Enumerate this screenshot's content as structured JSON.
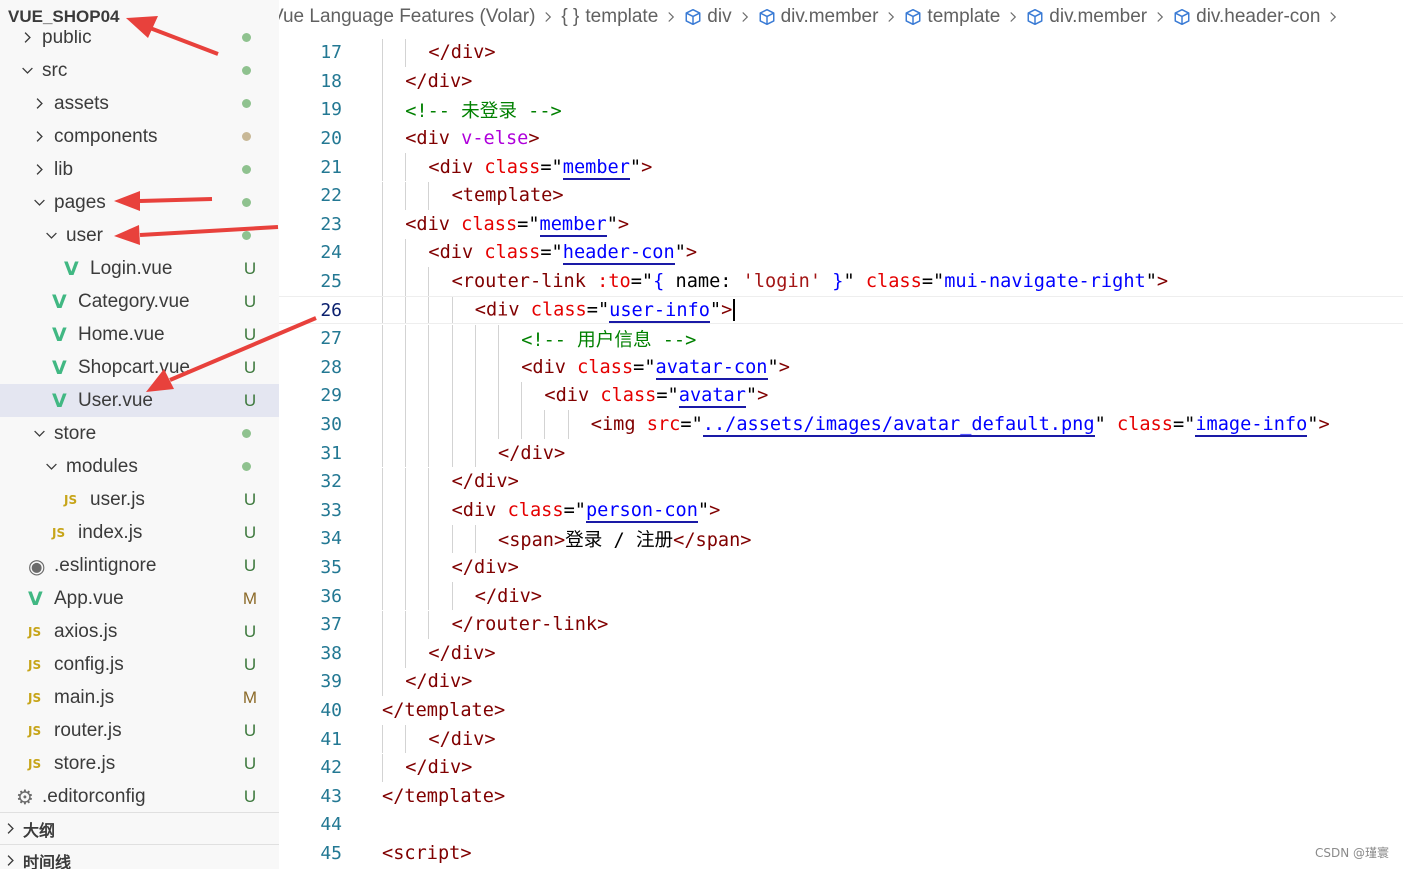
{
  "explorer": {
    "root": "VUE_SHOP04",
    "items": [
      {
        "label": "public",
        "kind": "folder",
        "open": false,
        "depth": 0,
        "status": "dot"
      },
      {
        "label": "src",
        "kind": "folder",
        "open": true,
        "depth": 0,
        "status": "dot"
      },
      {
        "label": "assets",
        "kind": "folder",
        "open": false,
        "depth": 1,
        "status": "dot"
      },
      {
        "label": "components",
        "kind": "folder",
        "open": false,
        "depth": 1,
        "status": "dot-mod"
      },
      {
        "label": "lib",
        "kind": "folder",
        "open": false,
        "depth": 1,
        "status": "dot"
      },
      {
        "label": "pages",
        "kind": "folder",
        "open": true,
        "depth": 1,
        "status": "dot"
      },
      {
        "label": "user",
        "kind": "folder",
        "open": true,
        "depth": 2,
        "status": "dot"
      },
      {
        "label": "Login.vue",
        "kind": "vue",
        "depth": 3,
        "status": "U"
      },
      {
        "label": "Category.vue",
        "kind": "vue",
        "depth": 2,
        "status": "U"
      },
      {
        "label": "Home.vue",
        "kind": "vue",
        "depth": 2,
        "status": "U"
      },
      {
        "label": "Shopcart.vue",
        "kind": "vue",
        "depth": 2,
        "status": "U"
      },
      {
        "label": "User.vue",
        "kind": "vue",
        "depth": 2,
        "status": "U",
        "selected": true
      },
      {
        "label": "store",
        "kind": "folder",
        "open": true,
        "depth": 1,
        "status": "dot"
      },
      {
        "label": "modules",
        "kind": "folder",
        "open": true,
        "depth": 2,
        "status": "dot"
      },
      {
        "label": "user.js",
        "kind": "js",
        "depth": 3,
        "status": "U"
      },
      {
        "label": "index.js",
        "kind": "js",
        "depth": 2,
        "status": "U"
      },
      {
        "label": ".eslintignore",
        "kind": "eslint",
        "depth": 0,
        "status": "U"
      },
      {
        "label": "App.vue",
        "kind": "vue",
        "depth": 0,
        "status": "M"
      },
      {
        "label": "axios.js",
        "kind": "js",
        "depth": 0,
        "status": "U"
      },
      {
        "label": "config.js",
        "kind": "js",
        "depth": 0,
        "status": "U"
      },
      {
        "label": "main.js",
        "kind": "js",
        "depth": 0,
        "status": "M"
      },
      {
        "label": "router.js",
        "kind": "js",
        "depth": 0,
        "status": "U"
      },
      {
        "label": "store.js",
        "kind": "js",
        "depth": 0,
        "status": "U"
      },
      {
        "label": ".editorconfig",
        "kind": "gear",
        "depth": -1,
        "status": "U"
      }
    ],
    "outline_label": "大纲",
    "timeline_label": "时间线",
    "js_badge": "JS",
    "vue_badge": "V",
    "eslint_glyph": "◉",
    "gear_glyph": "⚙"
  },
  "breadcrumb": [
    {
      "label": "Vue Language Features (Volar)",
      "icon": "none"
    },
    {
      "label": "template",
      "icon": "braces-icon",
      "icon_text": "{ }"
    },
    {
      "label": "div",
      "icon": "cube-icon"
    },
    {
      "label": "div.member",
      "icon": "cube-icon"
    },
    {
      "label": "template",
      "icon": "cube-icon"
    },
    {
      "label": "div.member",
      "icon": "cube-icon"
    },
    {
      "label": "div.header-con",
      "icon": "cube-icon"
    }
  ],
  "editor": {
    "active_line": 26,
    "lines": [
      {
        "n": "17",
        "indent": 2,
        "tokens": [
          [
            "tag",
            "</div>"
          ]
        ]
      },
      {
        "n": "18",
        "indent": 1,
        "tokens": [
          [
            "tag",
            "</div>"
          ]
        ]
      },
      {
        "n": "19",
        "indent": 1,
        "tokens": [
          [
            "comment",
            "<!-- 未登录 -->"
          ]
        ]
      },
      {
        "n": "20",
        "indent": 1,
        "tokens": [
          [
            "tag",
            "<div "
          ],
          [
            "dir",
            "v-else"
          ],
          [
            "tag",
            ">"
          ]
        ]
      },
      {
        "n": "21",
        "indent": 2,
        "tokens": [
          [
            "tag",
            "<div "
          ],
          [
            "attr",
            "class"
          ],
          [
            "punc",
            "=\""
          ],
          [
            "link",
            "member"
          ],
          [
            "punc",
            "\""
          ],
          [
            "tag",
            ">"
          ]
        ]
      },
      {
        "n": "22",
        "indent": 3,
        "tokens": [
          [
            "tag",
            "<template>"
          ]
        ]
      },
      {
        "n": "23",
        "indent": 1,
        "tokens": [
          [
            "tag",
            "<div "
          ],
          [
            "attr",
            "class"
          ],
          [
            "punc",
            "=\""
          ],
          [
            "link",
            "member"
          ],
          [
            "punc",
            "\""
          ],
          [
            "tag",
            ">"
          ]
        ]
      },
      {
        "n": "24",
        "indent": 2,
        "tokens": [
          [
            "tag",
            "<div "
          ],
          [
            "attr",
            "class"
          ],
          [
            "punc",
            "=\""
          ],
          [
            "link",
            "header-con"
          ],
          [
            "punc",
            "\""
          ],
          [
            "tag",
            ">"
          ]
        ]
      },
      {
        "n": "25",
        "indent": 3,
        "tokens": [
          [
            "tag",
            "<router-link "
          ],
          [
            "attr",
            ":to"
          ],
          [
            "punc",
            "=\""
          ],
          [
            "val",
            "{ "
          ],
          [
            "text",
            "name: "
          ],
          [
            "str",
            "'login'"
          ],
          [
            "val",
            " }"
          ],
          [
            "punc",
            "\" "
          ],
          [
            "attr",
            "class"
          ],
          [
            "punc",
            "=\""
          ],
          [
            "val",
            "mui-navigate-right"
          ],
          [
            "punc",
            "\""
          ],
          [
            "tag",
            ">"
          ]
        ]
      },
      {
        "n": "26",
        "indent": 4,
        "tokens": [
          [
            "tag",
            "<div "
          ],
          [
            "attr",
            "class"
          ],
          [
            "punc",
            "=\""
          ],
          [
            "link",
            "user-info"
          ],
          [
            "punc",
            "\""
          ],
          [
            "tag",
            ">"
          ]
        ],
        "cursor": true
      },
      {
        "n": "27",
        "indent": 6,
        "tokens": [
          [
            "comment",
            "<!-- 用户信息 -->"
          ]
        ]
      },
      {
        "n": "28",
        "indent": 6,
        "tokens": [
          [
            "tag",
            "<div "
          ],
          [
            "attr",
            "class"
          ],
          [
            "punc",
            "=\""
          ],
          [
            "link",
            "avatar-con"
          ],
          [
            "punc",
            "\""
          ],
          [
            "tag",
            ">"
          ]
        ]
      },
      {
        "n": "29",
        "indent": 7,
        "tokens": [
          [
            "tag",
            "<div "
          ],
          [
            "attr",
            "class"
          ],
          [
            "punc",
            "=\""
          ],
          [
            "link",
            "avatar"
          ],
          [
            "punc",
            "\""
          ],
          [
            "tag",
            ">"
          ]
        ]
      },
      {
        "n": "30",
        "indent": 9,
        "tokens": [
          [
            "tag",
            "<img "
          ],
          [
            "attr",
            "src"
          ],
          [
            "punc",
            "=\""
          ],
          [
            "link",
            "../assets/images/avatar_default.png"
          ],
          [
            "punc",
            "\" "
          ],
          [
            "attr",
            "class"
          ],
          [
            "punc",
            "=\""
          ],
          [
            "link",
            "image-info"
          ],
          [
            "punc",
            "\""
          ],
          [
            "tag",
            ">"
          ]
        ]
      },
      {
        "n": "31",
        "indent": 5,
        "tokens": [
          [
            "tag",
            "</div>"
          ]
        ]
      },
      {
        "n": "32",
        "indent": 3,
        "tokens": [
          [
            "tag",
            "</div>"
          ]
        ]
      },
      {
        "n": "33",
        "indent": 3,
        "tokens": [
          [
            "tag",
            "<div "
          ],
          [
            "attr",
            "class"
          ],
          [
            "punc",
            "=\""
          ],
          [
            "link",
            "person-con"
          ],
          [
            "punc",
            "\""
          ],
          [
            "tag",
            ">"
          ]
        ]
      },
      {
        "n": "34",
        "indent": 5,
        "tokens": [
          [
            "tag",
            "<span>"
          ],
          [
            "text",
            "登录 / 注册"
          ],
          [
            "tag",
            "</span>"
          ]
        ]
      },
      {
        "n": "35",
        "indent": 3,
        "tokens": [
          [
            "tag",
            "</div>"
          ]
        ]
      },
      {
        "n": "36",
        "indent": 4,
        "tokens": [
          [
            "tag",
            "</div>"
          ]
        ]
      },
      {
        "n": "37",
        "indent": 3,
        "tokens": [
          [
            "tag",
            "</router-link>"
          ]
        ]
      },
      {
        "n": "38",
        "indent": 2,
        "tokens": [
          [
            "tag",
            "</div>"
          ]
        ]
      },
      {
        "n": "39",
        "indent": 1,
        "tokens": [
          [
            "tag",
            "</div>"
          ]
        ]
      },
      {
        "n": "40",
        "indent": 0,
        "tokens": [
          [
            "tag",
            "</template>"
          ]
        ]
      },
      {
        "n": "41",
        "indent": 2,
        "tokens": [
          [
            "tag",
            "</div>"
          ]
        ]
      },
      {
        "n": "42",
        "indent": 1,
        "tokens": [
          [
            "tag",
            "</div>"
          ]
        ]
      },
      {
        "n": "43",
        "indent": 0,
        "tokens": [
          [
            "tag",
            "</template>"
          ]
        ]
      },
      {
        "n": "44",
        "indent": 0,
        "tokens": []
      },
      {
        "n": "45",
        "indent": 0,
        "tokens": [
          [
            "tag",
            "<script>"
          ]
        ]
      }
    ]
  },
  "watermark": "CSDN @瑾寰",
  "colors": {
    "annotation_arrow": "#e8413c",
    "selected_row": "#e4e6f1",
    "vue_green": "#41b883",
    "js_yellow": "#c7a51a"
  }
}
